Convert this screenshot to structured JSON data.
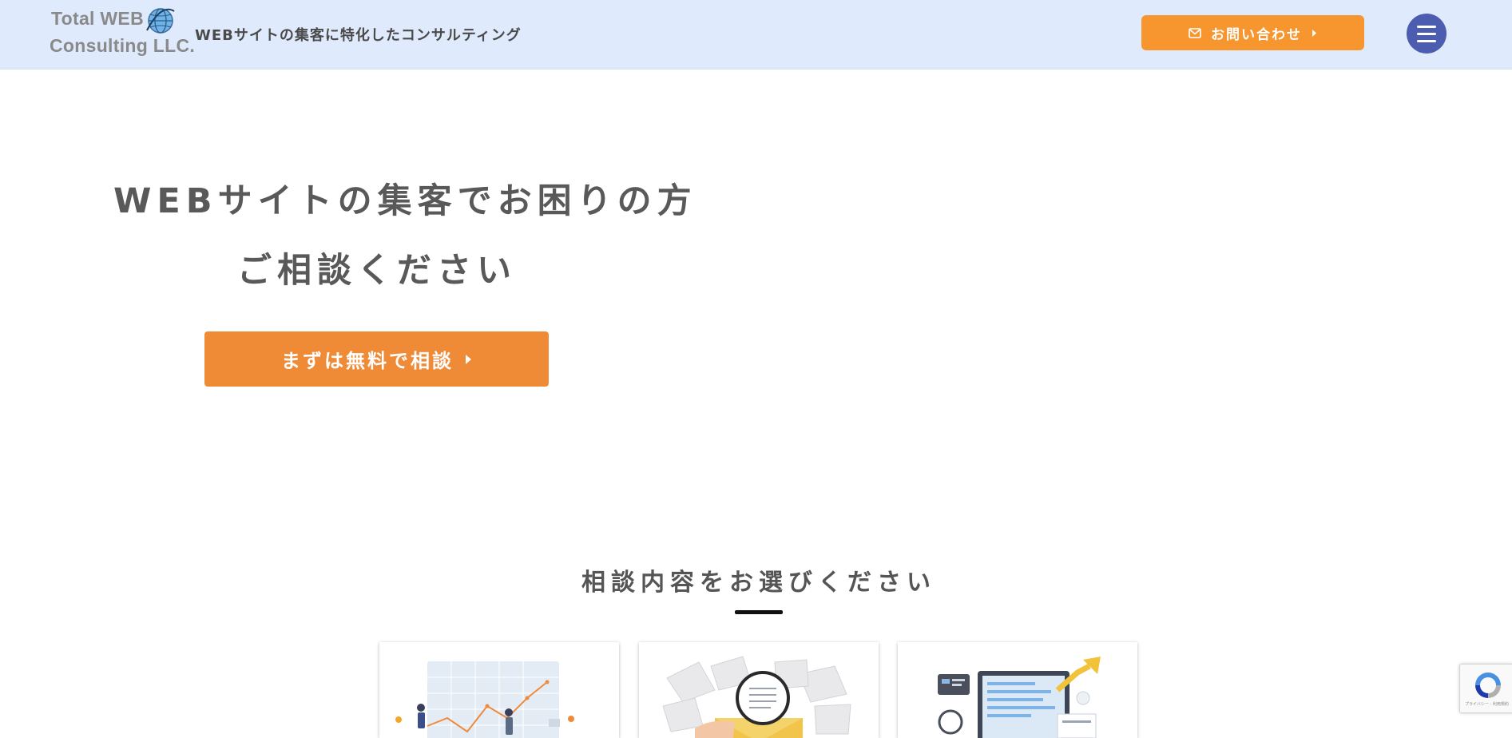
{
  "header": {
    "logo": {
      "line1": "Total WEB",
      "line2": "Consulting LLC."
    },
    "tagline": "WEBサイトの集客に特化したコンサルティング",
    "contact_button": {
      "label": "お問い合わせ",
      "icon": "envelope-icon",
      "color": "#f7962f"
    },
    "menu_button": {
      "icon": "hamburger-menu-icon",
      "color": "#4c5db0"
    },
    "background": "#dfeafc"
  },
  "hero": {
    "line1": "WEBサイトの集客でお困りの方",
    "line2": "ご相談ください",
    "cta_button": {
      "label": "まずは無料で相談",
      "color": "#ef8a36"
    }
  },
  "consult_section": {
    "title": "相談内容をお選びください",
    "cards": [
      {
        "image": "analytics-chart-illustration"
      },
      {
        "image": "email-magnifier-illustration"
      },
      {
        "image": "web-seo-growth-illustration"
      }
    ]
  },
  "recaptcha": {
    "text": "プライバシー - 利用規約"
  }
}
